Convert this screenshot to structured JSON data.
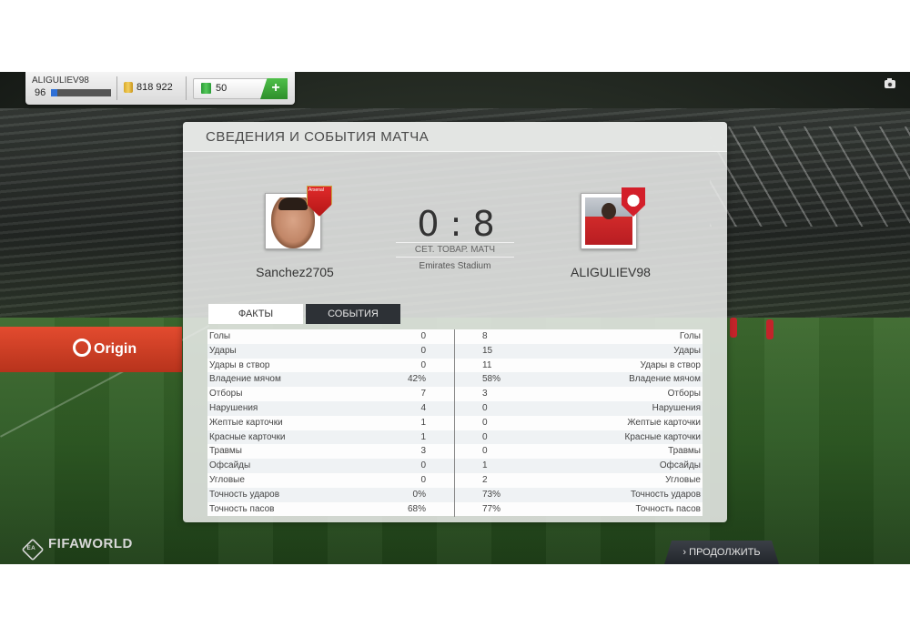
{
  "user": {
    "name": "ALIGULIEV98",
    "level": "96",
    "xp_progress": 0.1,
    "coins": "818 922",
    "points": "50",
    "add_label": "+"
  },
  "modal": {
    "title": "СВЕДЕНИЯ И СОБЫТИЯ МАТЧА",
    "home": {
      "name": "Sanchez2705",
      "crest_text": "Arsenal"
    },
    "away": {
      "name": "ALIGULIEV98"
    },
    "score": "0 : 8",
    "match_type": "СЕТ. ТОВАР. МАТЧ",
    "stadium": "Emirates Stadium",
    "tabs": [
      {
        "label": "ФАКТЫ",
        "active": true
      },
      {
        "label": "СОБЫТИЯ",
        "active": false
      }
    ],
    "stats": [
      {
        "label": "Голы",
        "home": "0",
        "away": "8"
      },
      {
        "label": "Удары",
        "home": "0",
        "away": "15"
      },
      {
        "label": "Удары в створ",
        "home": "0",
        "away": "11"
      },
      {
        "label": "Владение мячом",
        "home": "42%",
        "away": "58%"
      },
      {
        "label": "Отборы",
        "home": "7",
        "away": "3"
      },
      {
        "label": "Нарушения",
        "home": "4",
        "away": "0"
      },
      {
        "label": "Жептые карточки",
        "home": "1",
        "away": "0"
      },
      {
        "label": "Красные карточки",
        "home": "1",
        "away": "0"
      },
      {
        "label": "Травмы",
        "home": "3",
        "away": "0"
      },
      {
        "label": "Офсайды",
        "home": "0",
        "away": "1"
      },
      {
        "label": "Угловые",
        "home": "0",
        "away": "2"
      },
      {
        "label": "Точность ударов",
        "home": "0%",
        "away": "73%"
      },
      {
        "label": "Точность пасов",
        "home": "68%",
        "away": "77%"
      }
    ]
  },
  "footer": {
    "logo_ea": "EA",
    "logo": "FIFAWORLD",
    "continue_label": "ПРОДОЛЖИТЬ",
    "continue_icon": "chevron-right-icon"
  },
  "background": {
    "ad_text": "Origin"
  },
  "colors": {
    "active_tab": "#ffffff",
    "inactive_tab": "#2d3136",
    "add_button": "#3fa83a",
    "xp_fill": "#2d6fd6"
  }
}
